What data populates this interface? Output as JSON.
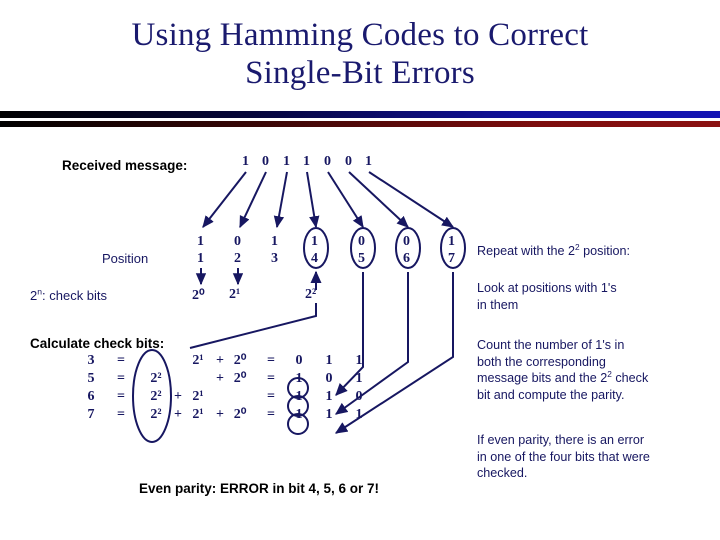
{
  "slide": {
    "title_line1": "Using Hamming Codes to Correct",
    "title_line2": "Single-Bit Errors",
    "accent_navy": "#1a1a6e",
    "accent_dark_red": "#8b1111"
  },
  "received": {
    "label": "Received message:",
    "bits": [
      "1",
      "0",
      "1",
      "1",
      "0",
      "0",
      "1"
    ]
  },
  "position_row": {
    "label": "Position",
    "bits": [
      "1",
      "0",
      "1",
      "1",
      "0",
      "0",
      "1"
    ],
    "numbers": [
      "1",
      "2",
      "3",
      "4",
      "5",
      "6",
      "7"
    ],
    "highlighted": [
      false,
      false,
      false,
      true,
      true,
      true,
      true
    ]
  },
  "check_bits_row": {
    "label_prefix": "2",
    "label_sup": "n",
    "label_suffix": ": check bits",
    "label_full": "2n: check bits",
    "powers": [
      "2⁰",
      "2¹",
      "2²"
    ]
  },
  "calculate": {
    "heading": "Calculate check bits:",
    "rows": [
      {
        "n": "3",
        "eq": "=",
        "t4": "",
        "p1": "",
        "t2": "2¹",
        "p2": "+",
        "t1": "2⁰",
        "eq2": "=",
        "bits": [
          "0",
          "1",
          "1"
        ],
        "circle_first": false
      },
      {
        "n": "5",
        "eq": "=",
        "t4": "2²",
        "p1": "",
        "t2": "",
        "p2": "+",
        "t1": "2⁰",
        "eq2": "=",
        "bits": [
          "1",
          "0",
          "1"
        ],
        "circle_first": true
      },
      {
        "n": "6",
        "eq": "=",
        "t4": "2²",
        "p1": "+",
        "t2": "2¹",
        "p2": "",
        "t1": "",
        "eq2": "=",
        "bits": [
          "1",
          "1",
          "0"
        ],
        "circle_first": true
      },
      {
        "n": "7",
        "eq": "=",
        "t4": "2²",
        "p1": "+",
        "t2": "2¹",
        "p2": "+",
        "t1": "2⁰",
        "eq2": "=",
        "bits": [
          "1",
          "1",
          "1"
        ],
        "circle_first": true
      }
    ]
  },
  "conclusion": {
    "text": "Even parity: ERROR in bit 4, 5, 6 or 7!"
  },
  "notes": {
    "note1_a": "Repeat with the 2",
    "note1_sup": "2",
    "note1_b": " position:",
    "note1_full": "Repeat with the 22 position:",
    "note2_line1": "Look at positions with  1's",
    "note2_line2": "in them",
    "note3_line1": "Count the number of 1's in",
    "note3_line2": "both the corresponding",
    "note3_line3_a": "message bits and the 2",
    "note3_line3_sup": "2",
    "note3_line3_b": " check",
    "note3_line3_full": "message bits and the 22 check",
    "note3_line4": "bit and compute the parity.",
    "note4_line1": "If even parity, there is an error",
    "note4_line2": "in one of the four bits that were",
    "note4_line3": "checked."
  }
}
